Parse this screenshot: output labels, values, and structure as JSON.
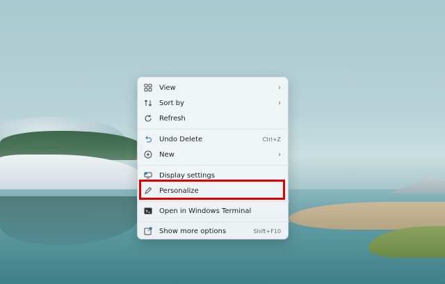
{
  "context_menu": {
    "items": [
      {
        "label": "View",
        "icon": "view-grid-icon",
        "submenu": true
      },
      {
        "label": "Sort by",
        "icon": "sort-arrows-icon",
        "submenu": true
      },
      {
        "label": "Refresh",
        "icon": "refresh-icon"
      },
      {
        "label": "Undo Delete",
        "icon": "undo-icon",
        "shortcut": "Ctrl+Z"
      },
      {
        "label": "New",
        "icon": "new-plus-icon",
        "submenu": true
      },
      {
        "label": "Display settings",
        "icon": "display-settings-icon"
      },
      {
        "label": "Personalize",
        "icon": "pencil-icon"
      },
      {
        "label": "Open in Windows Terminal",
        "icon": "terminal-icon"
      },
      {
        "label": "Show more options",
        "icon": "show-more-icon",
        "shortcut": "Shift+F10"
      }
    ]
  },
  "highlight_color": "#e00000"
}
